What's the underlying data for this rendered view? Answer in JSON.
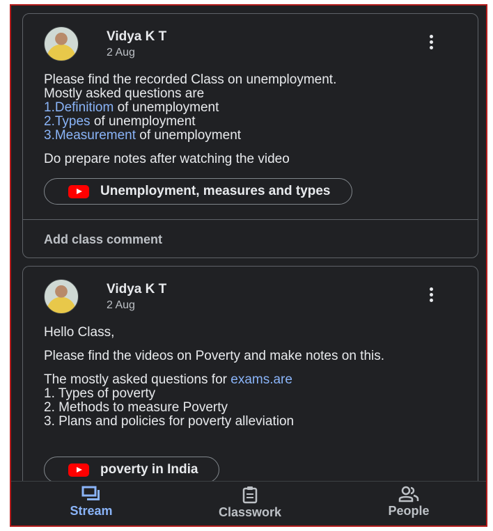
{
  "posts": [
    {
      "author": "Vidya K T",
      "date": "2 Aug",
      "intro_lines": [
        "Please find the recorded Class on unemployment.",
        "Mostly asked questions are"
      ],
      "items": [
        {
          "link": "1.Definitiom",
          "rest": " of unemployment"
        },
        {
          "link": "2.Types",
          "rest": " of unemployment"
        },
        {
          "link": "3.Measurement",
          "rest": " of unemployment"
        }
      ],
      "closing": "Do prepare notes after watching the video",
      "attachment": "Unemployment, measures and types",
      "comment_placeholder": "Add class comment"
    },
    {
      "author": "Vidya K T",
      "date": "2 Aug",
      "greeting": "Hello Class,",
      "paragraph": "Please find the videos on Poverty and make notes on this.",
      "questions_prefix": "The mostly asked questions for ",
      "questions_link": "exams.are",
      "list": [
        "1. Types of poverty",
        "2. Methods to measure Poverty",
        "3. Plans and policies for poverty alleviation"
      ],
      "attachment": "poverty in India"
    }
  ],
  "nav": [
    {
      "label": "Stream",
      "icon": "stream-icon",
      "active": true
    },
    {
      "label": "Classwork",
      "icon": "classwork-icon",
      "active": false
    },
    {
      "label": "People",
      "icon": "people-icon",
      "active": false
    }
  ],
  "colors": {
    "background": "#202124",
    "accent": "#8ab4f8",
    "youtube": "#ff0000"
  }
}
